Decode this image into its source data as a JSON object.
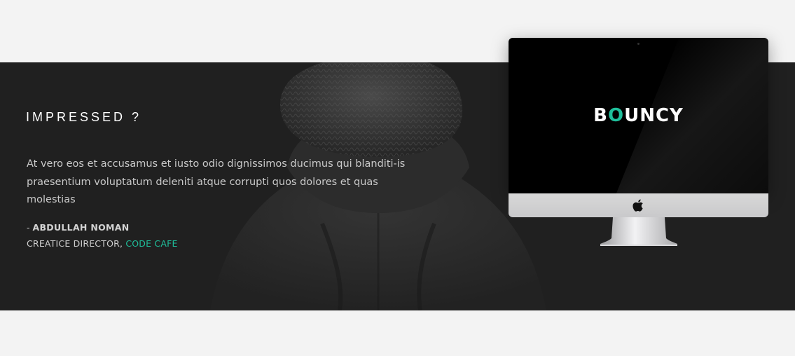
{
  "testimonial": {
    "heading": "IMPRESSED ?",
    "quote": "At vero eos et accusamus et iusto odio dignissimos ducimus qui blanditi-is praesentium voluptatum deleniti atque corrupti quos dolores et quas molestias",
    "author_prefix": "- ",
    "author_name": "ABDULLAH NOMAN",
    "role": "CREATICE DIRECTOR, ",
    "company": "CODE CAFE"
  },
  "device": {
    "logo_prefix": "B",
    "logo_accent": "O",
    "logo_suffix": "UNCY",
    "icon": "apple-logo-icon"
  },
  "colors": {
    "accent": "#1fbf9b",
    "band": "#202020",
    "page": "#f3f3f3"
  }
}
